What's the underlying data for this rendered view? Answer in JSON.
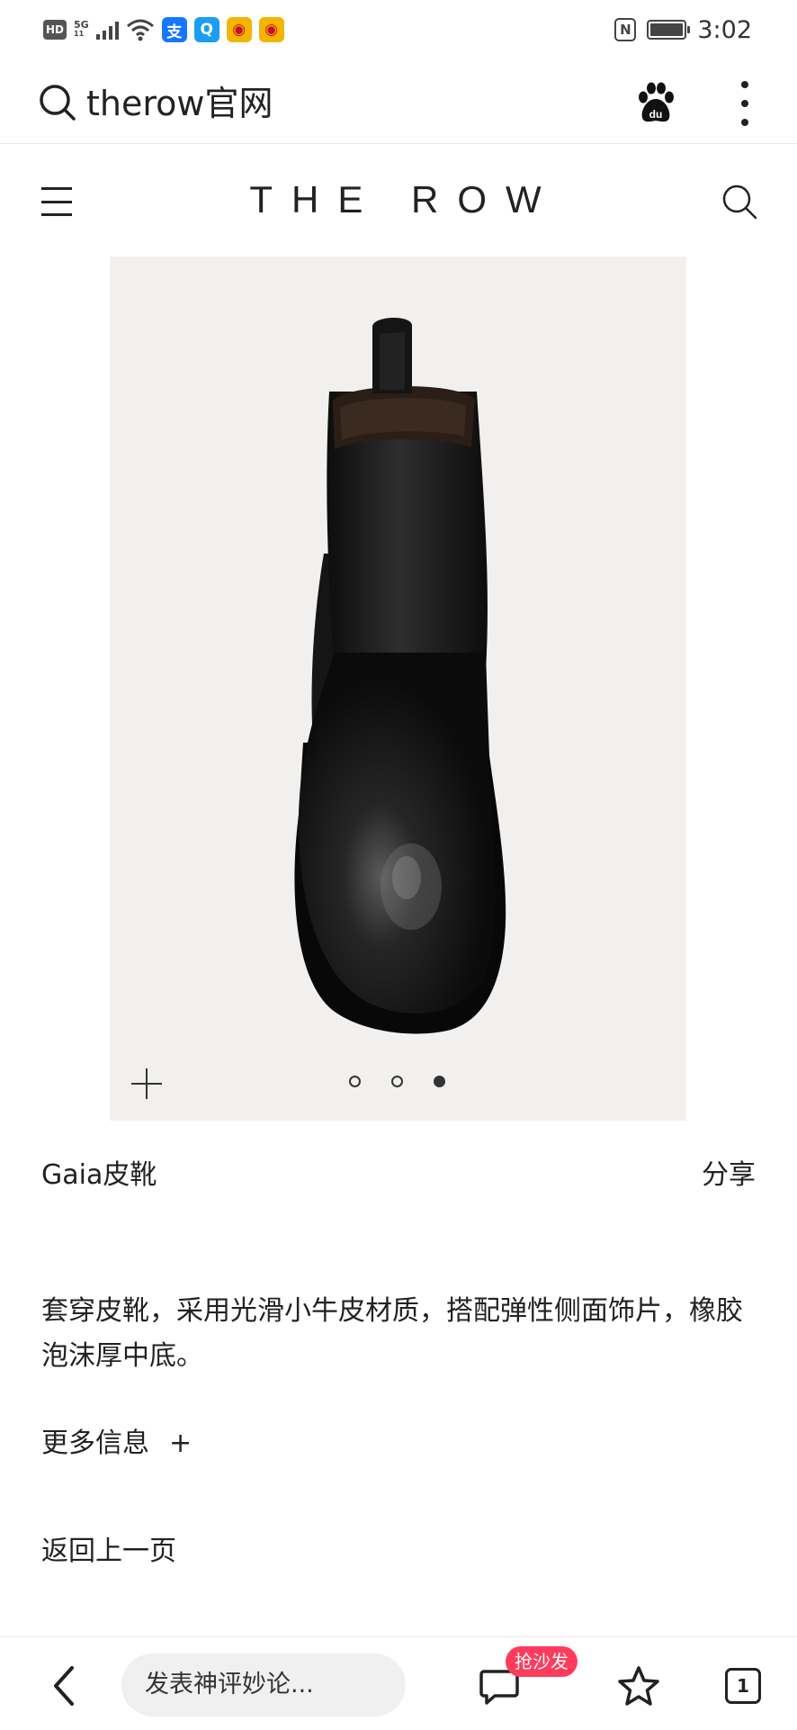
{
  "status_bar": {
    "hd": "HD",
    "network": "5G",
    "network_sub": "11",
    "nfc": "N",
    "time": "3:02",
    "app_icons": [
      {
        "name": "alipay-icon",
        "glyph": "支",
        "color": "#1677ff"
      },
      {
        "name": "search-app-icon",
        "glyph": "Q",
        "color": "#1a9df5"
      },
      {
        "name": "weibo-icon",
        "glyph": "◉",
        "color": "#f5b400"
      },
      {
        "name": "weibo-icon",
        "glyph": "◉",
        "color": "#f5b400"
      }
    ]
  },
  "browser": {
    "address_text": "therow官网"
  },
  "site": {
    "brand": "THE ROW"
  },
  "gallery": {
    "slide_count": 3,
    "active_slide": 3
  },
  "product": {
    "name": "Gaia皮靴",
    "share": "分享",
    "description": "套穿皮靴，采用光滑小牛皮材质，搭配弹性侧面饰片，橡胶泡沫厚中底。",
    "more_info": "更多信息",
    "more_info_plus": "+",
    "back": "返回上一页"
  },
  "toolbar": {
    "comment_placeholder": "发表神评妙论...",
    "sofa_badge": "抢沙发",
    "tab_count": "1"
  },
  "colors": {
    "badge": "#ff3b5c",
    "gallery_bg": "#f1f0ee"
  }
}
